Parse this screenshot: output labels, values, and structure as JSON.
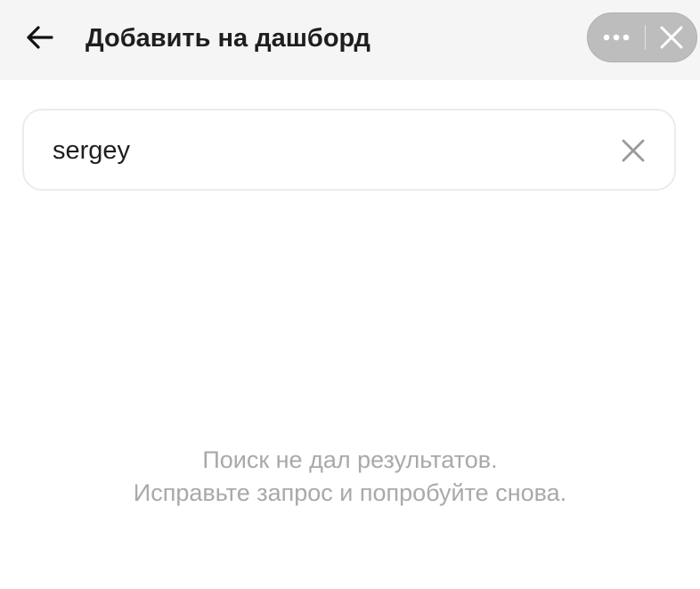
{
  "header": {
    "title": "Добавить на дашборд",
    "back_icon": "arrow-left-icon",
    "more_icon": "more-dots-icon",
    "close_icon": "close-icon",
    "background": "#f5f5f5",
    "capsule_color": "#bdbdbd"
  },
  "search": {
    "value": "sergey",
    "clear_icon": "clear-x-icon"
  },
  "empty_state": {
    "line1": "Поиск не дал результатов.",
    "line2": "Исправьте запрос и попробуйте снова.",
    "color": "#a9a9a9"
  }
}
